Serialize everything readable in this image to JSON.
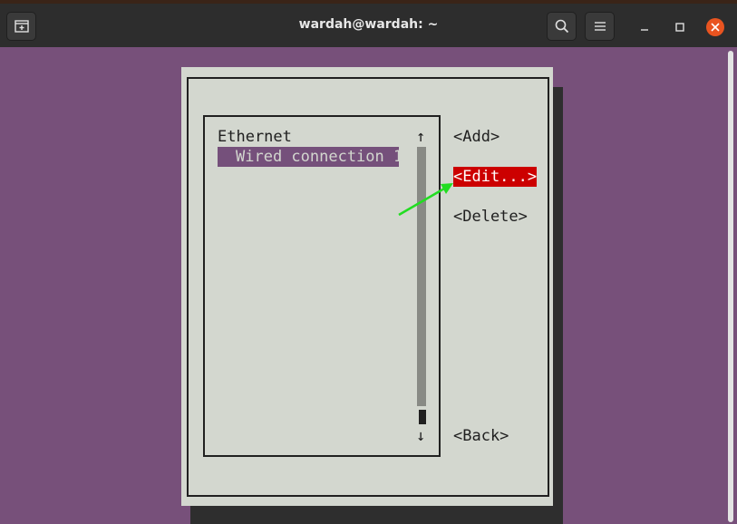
{
  "window": {
    "title": "wardah@wardah: ~",
    "icons": [
      "new-tab-icon",
      "search-icon",
      "hamburger-menu-icon",
      "minimize-icon",
      "maximize-icon",
      "close-icon"
    ]
  },
  "colors": {
    "terminal_bg": "#77507a",
    "dialog_bg": "#d3d7cf",
    "selected_bg": "#75507b",
    "edit_highlight": "#cc0000",
    "annotation_arrow": "#22dd22",
    "close_button": "#e95420"
  },
  "nmtui": {
    "list_header": "Ethernet",
    "connections": [
      "Wired connection 1"
    ],
    "selected_connection": "Wired connection 1",
    "scroll_up": "↑",
    "scroll_down": "↓",
    "buttons": {
      "add": "<Add>",
      "edit": "<Edit...>",
      "delete": "<Delete>",
      "back": "<Back>"
    },
    "focused_button": "edit"
  }
}
